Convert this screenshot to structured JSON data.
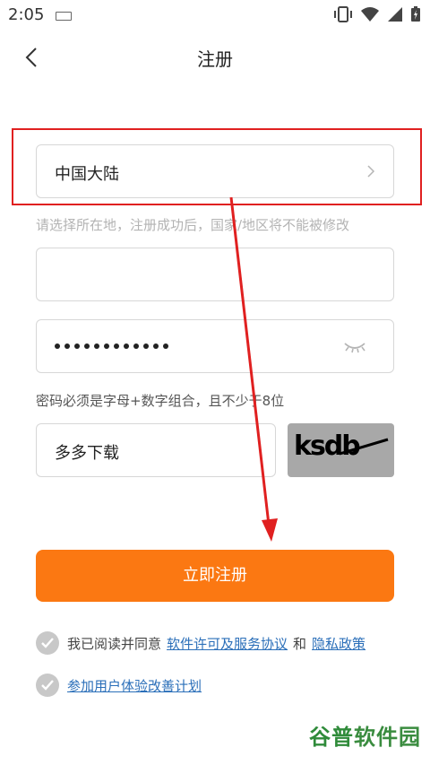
{
  "status_bar": {
    "time": "2:05"
  },
  "nav": {
    "title": "注册"
  },
  "region": {
    "value": "中国大陆",
    "hint": "请选择所在地，注册成功后，国家/地区将不能被修改"
  },
  "phone": {
    "value": ""
  },
  "password": {
    "masked": "••••••••••••",
    "hint": "密码必须是字母+数字组合，且不少于8位"
  },
  "captcha": {
    "value": "多多下载",
    "image_text": "ksdb"
  },
  "submit": {
    "label": "立即注册"
  },
  "agreement": {
    "prefix": "我已阅读并同意",
    "license_link": "软件许可及服务协议",
    "and": "和",
    "privacy_link": "隐私政策"
  },
  "experience": {
    "link": "参加用户体验改善计划"
  },
  "watermark": {
    "part1": "谷普",
    "part2": "软件园"
  },
  "colors": {
    "accent": "#fb7812",
    "link": "#2b6fb9",
    "annotation": "#e02020"
  }
}
